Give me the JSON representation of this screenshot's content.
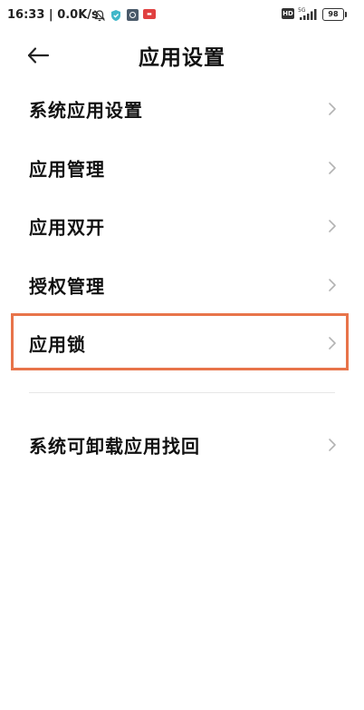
{
  "status_bar": {
    "time": "16:33",
    "speed": "0.0K/s",
    "hd": "HD",
    "network": "5G",
    "battery": "98"
  },
  "header": {
    "title": "应用设置"
  },
  "menu": {
    "items": [
      {
        "label": "系统应用设置"
      },
      {
        "label": "应用管理"
      },
      {
        "label": "应用双开"
      },
      {
        "label": "授权管理"
      },
      {
        "label": "应用锁",
        "highlighted": true
      },
      {
        "label": "系统可卸载应用找回"
      }
    ]
  },
  "colors": {
    "highlight_border": "#e8744a",
    "chevron": "#b3b3b3",
    "text": "#111111"
  },
  "icons": {
    "back": "arrow-left-icon",
    "chevron": "chevron-right-icon"
  }
}
